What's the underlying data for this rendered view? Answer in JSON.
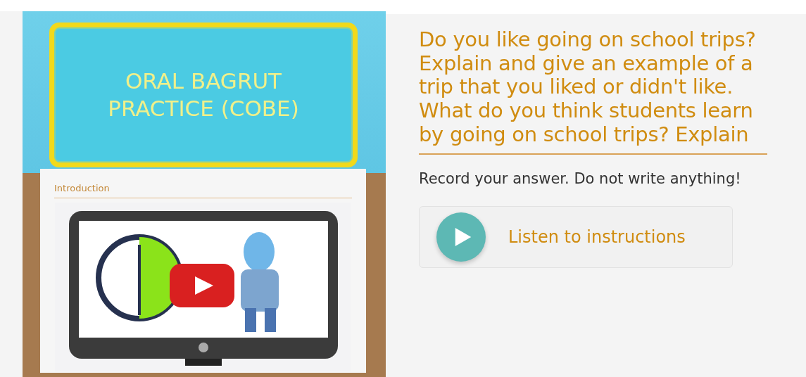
{
  "banner": {
    "title": "ORAL BAGRUT PRACTICE (COBE)"
  },
  "section": {
    "heading": "Introduction"
  },
  "question": "Do you like going on school trips? Explain and give an example of a trip that you liked or didn't like. What do you think students learn by going on school trips? Explain",
  "instruction": "Record your answer. Do not write anything!",
  "listen_button": {
    "label": "Listen to instructions"
  }
}
